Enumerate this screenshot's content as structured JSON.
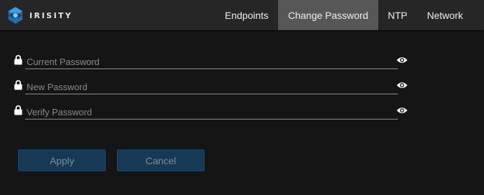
{
  "brand": {
    "name": "IRISITY",
    "logo_icon": "irisity-logo",
    "logo_color": "#2f8fd8"
  },
  "nav": {
    "items": [
      {
        "label": "Endpoints",
        "active": false
      },
      {
        "label": "Change Password",
        "active": true
      },
      {
        "label": "NTP",
        "active": false
      },
      {
        "label": "Network",
        "active": false
      }
    ]
  },
  "form": {
    "fields": [
      {
        "placeholder": "Current Password",
        "value": "",
        "lock_icon": "lock-icon",
        "toggle_icon": "eye-icon"
      },
      {
        "placeholder": "New Password",
        "value": "",
        "lock_icon": "lock-icon",
        "toggle_icon": "eye-icon"
      },
      {
        "placeholder": "Verify Password",
        "value": "",
        "lock_icon": "lock-icon",
        "toggle_icon": "eye-icon"
      }
    ]
  },
  "actions": {
    "apply_label": "Apply",
    "cancel_label": "Cancel"
  },
  "colors": {
    "background": "#151515",
    "topbar": "#262626",
    "active_tab": "#575757",
    "button_fill": "#163a55",
    "button_text": "#7d8d99"
  }
}
